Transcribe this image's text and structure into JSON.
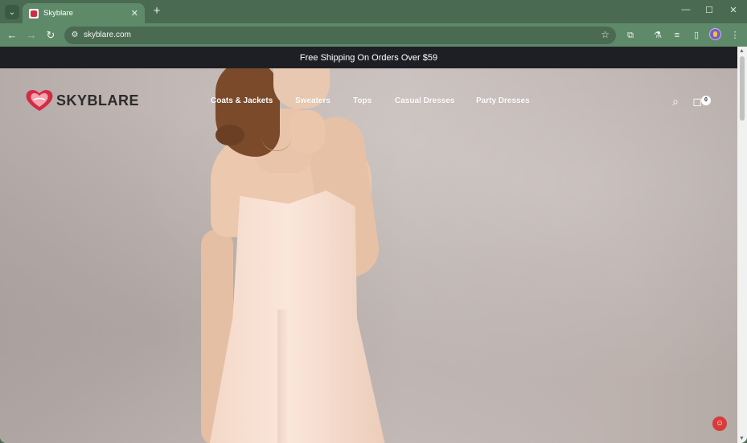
{
  "browser": {
    "tab_title": "Skyblare",
    "tab_close": "✕",
    "new_tab": "+",
    "url": "skyblare.com",
    "window_controls": [
      "—",
      "☐",
      "✕"
    ]
  },
  "site": {
    "announcement": "Free Shipping On Orders Over $59",
    "logo_text": "SKYBLARE",
    "nav": [
      {
        "label": "Coats & Jackets"
      },
      {
        "label": "Sweaters"
      },
      {
        "label": "Tops"
      },
      {
        "label": "Casual Dresses"
      },
      {
        "label": "Party Dresses"
      }
    ],
    "cart_count": "0"
  },
  "icons": {
    "tab_menu": "chevron-down-icon",
    "back": "arrow-left-icon",
    "forward": "arrow-right-icon",
    "reload": "reload-icon",
    "site_info": "tune-icon",
    "bookmark": "star-icon",
    "extensions": "puzzle-icon",
    "labs": "flask-icon",
    "media": "playlist-icon",
    "sidepanel": "sidepanel-icon",
    "menu": "more-vertical-icon",
    "search": "search-icon",
    "cart": "bag-icon",
    "chat": "chat-icon"
  },
  "colors": {
    "browser_frame": "#4a6b52",
    "tab_active": "#5f8a69",
    "announcement_bg": "#1e1f24",
    "brand_red": "#d22c44"
  }
}
